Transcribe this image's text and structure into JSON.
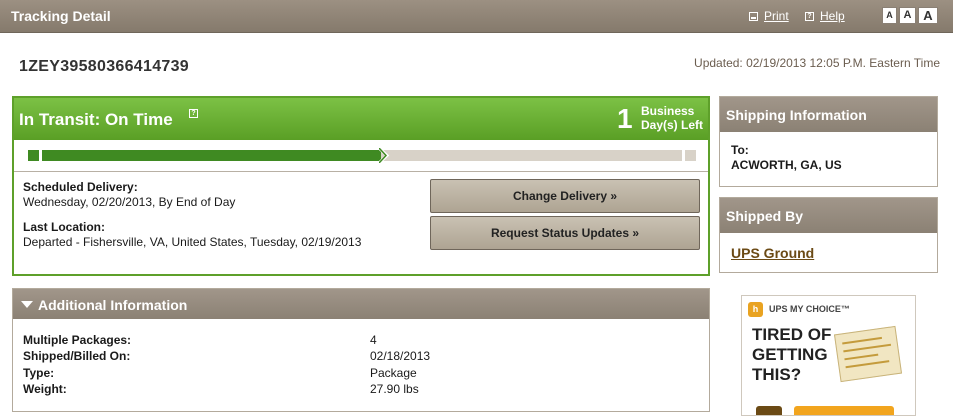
{
  "header": {
    "title": "Tracking Detail",
    "print_label": "Print",
    "help_label": "Help",
    "font_sizes": [
      "A",
      "A",
      "A"
    ]
  },
  "tracking": {
    "number": "1ZEY39580366414739",
    "updated": "Updated: 02/19/2013 12:05 P.M. Eastern Time"
  },
  "status": {
    "title": "In Transit: On Time",
    "help_glyph": "?",
    "days_left": "1",
    "days_label_line1": "Business",
    "days_label_line2": "Day(s) Left",
    "progress_fraction": 0.53,
    "scheduled_label": "Scheduled Delivery:",
    "scheduled_value": "Wednesday, 02/20/2013, By End of Day",
    "last_location_label": "Last Location:",
    "last_location_value": "Departed - Fishersville, VA, United States, Tuesday, 02/19/2013",
    "change_delivery_label": "Change Delivery »",
    "request_updates_label": "Request Status Updates »"
  },
  "shipping_info": {
    "title": "Shipping Information",
    "to_label": "To:",
    "to_value": "ACWORTH, GA, US"
  },
  "shipped_by": {
    "title": "Shipped By",
    "service": "UPS Ground"
  },
  "additional": {
    "title": "Additional Information",
    "rows": [
      {
        "label": "Multiple Packages:",
        "value": "4"
      },
      {
        "label": "Shipped/Billed On:",
        "value": "02/18/2013"
      },
      {
        "label": "Type:",
        "value": "Package"
      },
      {
        "label": "Weight:",
        "value": "27.90 lbs"
      }
    ]
  },
  "ad": {
    "logo_glyph": "h",
    "brand": "UPS MY CHOICE™",
    "headline": "TIRED OF\nGETTING\nTHIS?"
  },
  "colors": {
    "header_bg": "#8b8174",
    "status_green": "#5ea02a",
    "progress_green": "#3f8a22",
    "link_brown": "#6b4a15"
  }
}
